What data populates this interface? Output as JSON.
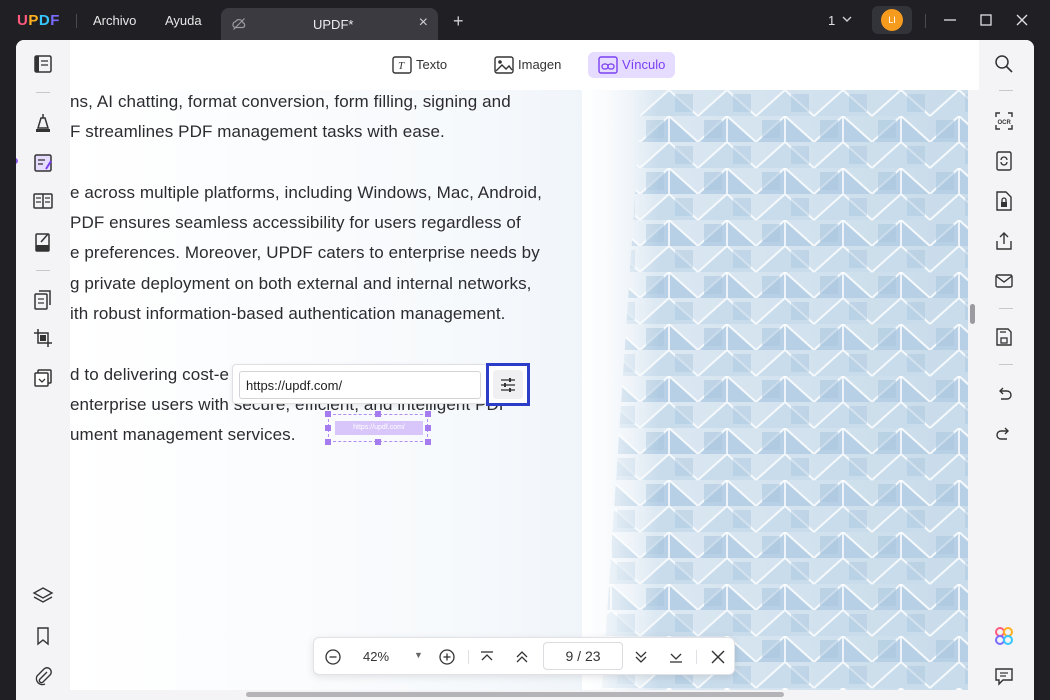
{
  "app": {
    "logo": [
      "U",
      "P",
      "D",
      "F"
    ],
    "menu": {
      "file": "Archivo",
      "help": "Ayuda"
    },
    "tab": {
      "title": "UPDF*"
    },
    "page_indicator": "1",
    "avatar_initials": "LI"
  },
  "toolbar": {
    "text_label": "Texto",
    "image_label": "Imagen",
    "link_label": "Vínculo",
    "active_tool": "link"
  },
  "document": {
    "lines": [
      "ns, AI chatting, format conversion, form filling, signing and",
      "F streamlines PDF management tasks with ease.",
      "e across multiple platforms, including Windows, Mac, Android,",
      "PDF ensures seamless accessibility for users regardless of",
      "e preferences. Moreover, UPDF caters to enterprise needs by",
      "g private deployment on both external and internal networks,",
      "ith robust information-based authentication management.",
      "d to delivering cost-e",
      " enterprise users with secure, efficient, and intelligent PDF",
      "ument management services."
    ]
  },
  "link_popup": {
    "url_value": "https://updf.com/",
    "link_box_text": "https://updf.com/"
  },
  "zoom_bar": {
    "zoom": "42%",
    "current_page": "9",
    "separator": "/",
    "total_pages": "23"
  },
  "colors": {
    "accent": "#7b3ff2",
    "active_bg": "#e6dcff",
    "highlight_border": "#2c3ec8",
    "titlebar_bg": "#1f1f24"
  },
  "icons": {
    "left_rail": [
      "reader-icon",
      "comment-icon",
      "edit-pdf-icon",
      "organize-pages-icon",
      "fill-sign-icon",
      "convert-icon",
      "crop-icon",
      "compress-icon",
      "layers-icon",
      "bookmark-icon",
      "attachment-icon"
    ],
    "right_rail": [
      "search-icon",
      "ocr-icon",
      "convert-icon",
      "protect-icon",
      "share-icon",
      "email-icon",
      "save-icon",
      "undo-icon",
      "redo-icon",
      "ai-assistant-icon",
      "comment-panel-icon"
    ]
  }
}
